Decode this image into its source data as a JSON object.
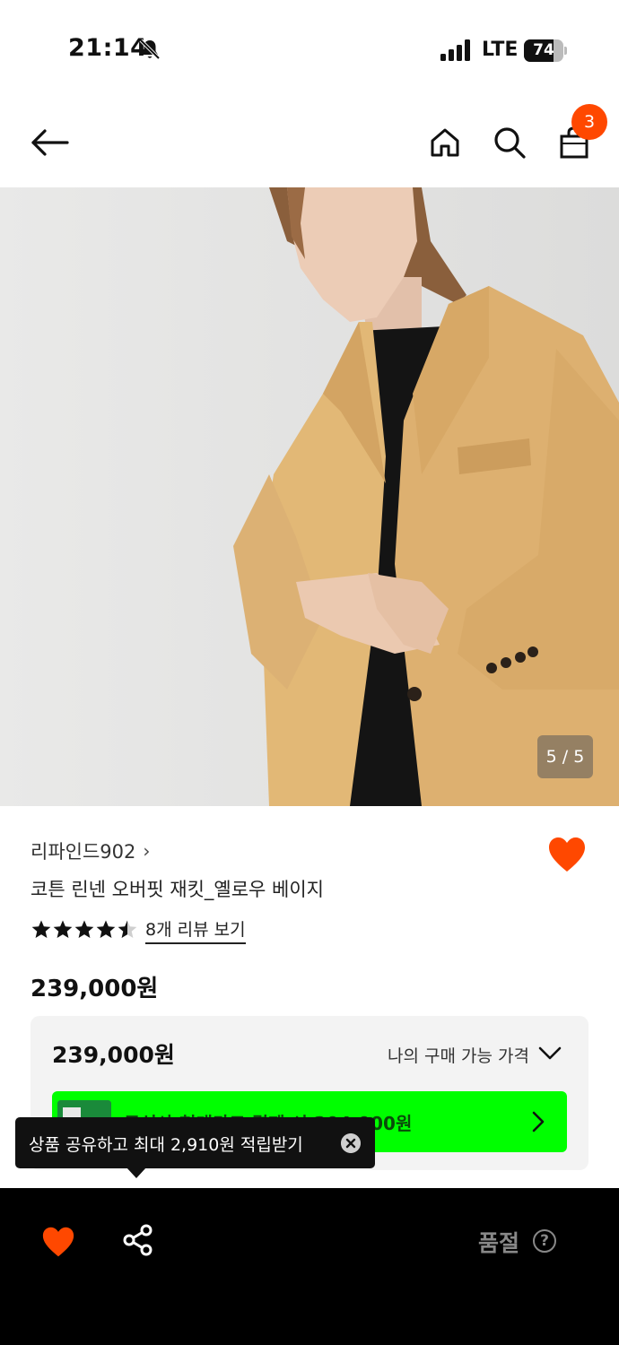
{
  "status_bar": {
    "time": "21:14",
    "network": "LTE",
    "battery": "74",
    "battery_level": 0.74
  },
  "header": {
    "cart_count": "3"
  },
  "gallery": {
    "counter": "5 / 5"
  },
  "product": {
    "brand": "리파인드902",
    "title": "코튼 린넨 오버핏 재킷_옐로우 베이지",
    "rating": 4.5,
    "review_link": "8개 리뷰 보기",
    "price": "239,000원"
  },
  "price_box": {
    "price": "239,000원",
    "my_price_label": "나의 구매 가능 가격",
    "promo_text": "무신사 현대카드 결제 시 204,900원"
  },
  "tooltip": {
    "text": "상품 공유하고 최대 2,910원 적립받기"
  },
  "bottom_bar": {
    "soldout_label": "품절",
    "help": "?"
  },
  "colors": {
    "accent": "#ff4800",
    "promo": "#00ff00",
    "bar": "#000000"
  }
}
